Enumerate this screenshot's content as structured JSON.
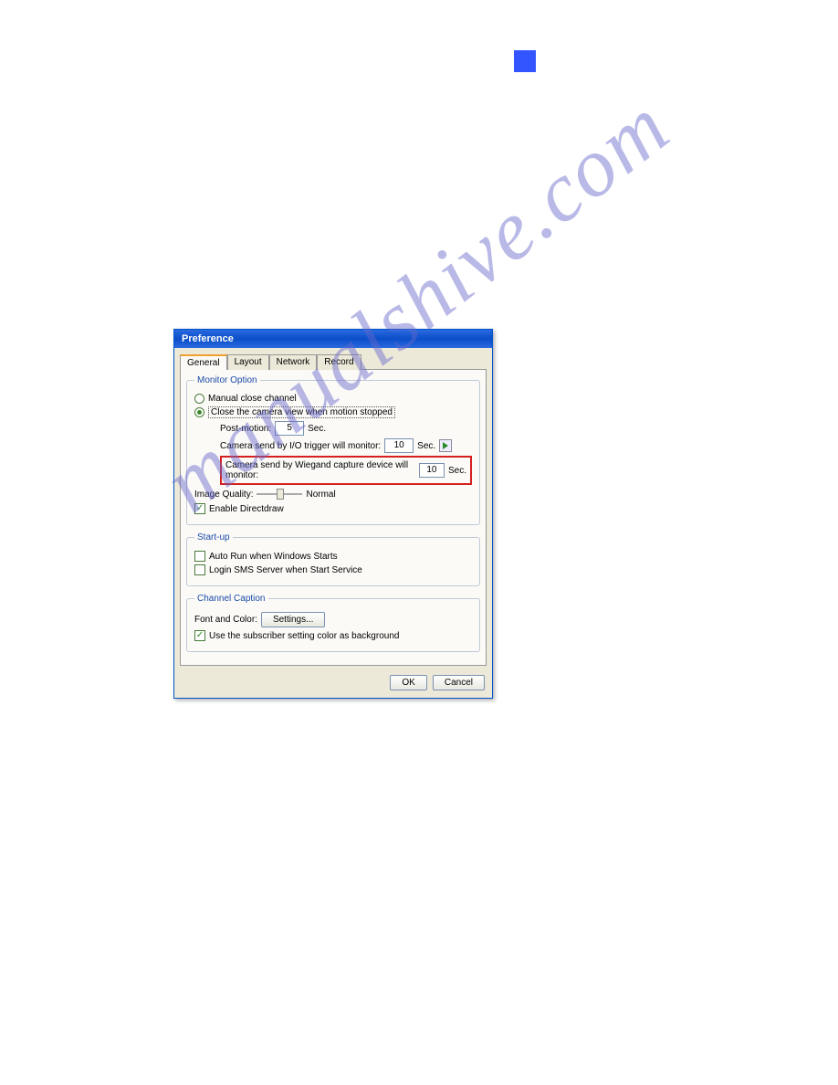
{
  "watermark": "manualshive.com",
  "dialog": {
    "title": "Preference",
    "tabs": [
      "General",
      "Layout",
      "Network",
      "Record"
    ],
    "active_tab": 0,
    "monitor_option": {
      "legend": "Monitor Option",
      "manual_close": "Manual close channel",
      "close_on_stop": "Close the camera view when motion stopped",
      "post_motion_label": "Post-motion:",
      "post_motion_value": "5",
      "sec": "Sec.",
      "io_trigger_label": "Camera send by I/O trigger will monitor:",
      "io_trigger_value": "10",
      "wiegand_label": "Camera send by Wiegand capture device will monitor:",
      "wiegand_value": "10",
      "image_quality_label": "Image Quality:",
      "image_quality_level": "Normal",
      "enable_directdraw": "Enable Directdraw"
    },
    "startup": {
      "legend": "Start-up",
      "auto_run": "Auto Run when Windows Starts",
      "login_sms": "Login SMS Server when Start Service"
    },
    "channel_caption": {
      "legend": "Channel Caption",
      "font_color_label": "Font and Color:",
      "settings_btn": "Settings...",
      "use_subscriber": "Use the subscriber setting color as background"
    },
    "buttons": {
      "ok": "OK",
      "cancel": "Cancel"
    }
  }
}
